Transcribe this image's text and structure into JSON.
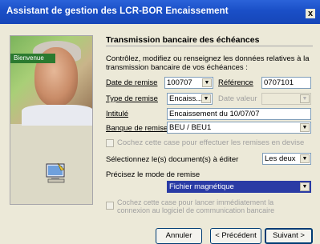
{
  "window": {
    "title": "Assistant de gestion des LCR-BOR Encaissement",
    "close_glyph": "x"
  },
  "sidebar": {
    "tab_label": "Bienvenue"
  },
  "section": {
    "heading": "Transmission bancaire des échéances",
    "description": "Contrôlez, modifiez ou renseignez les données relatives à la transmission bancaire de vos échéances :"
  },
  "form": {
    "date_remise_label": "Date de remise",
    "date_remise_value": "100707",
    "reference_label": "Référence",
    "reference_value": "0707101",
    "type_remise_label": "Type de remise",
    "type_remise_value": "Encaiss...",
    "date_valeur_label": "Date valeur",
    "intitule_label": "Intitulé",
    "intitule_value": "Encaissement du 10/07/07",
    "banque_label": "Banque de remise",
    "banque_value": "BEU / BEU1",
    "checkbox_devise_label": "Cochez cette case pour effectuer les remises en devise",
    "documents_label": "Sélectionnez le(s) document(s) à éditer",
    "documents_value": "Les deux",
    "mode_label": "Précisez le mode de remise",
    "mode_value": "Fichier magnétique",
    "checkbox_connexion_label": "Cochez cette case pour lancer immédiatement la connexion au logiciel de communication bancaire"
  },
  "buttons": {
    "annuler": "Annuler",
    "precedent": "< Précédent",
    "suivant": "Suivant >"
  },
  "icons": {
    "dropdown": "chevron-down-icon",
    "assistant": "computer-wizard-icon"
  },
  "colors": {
    "titlebar": "#1a4fc7",
    "selection": "#2a3ba5",
    "panel": "#ece9d8"
  }
}
